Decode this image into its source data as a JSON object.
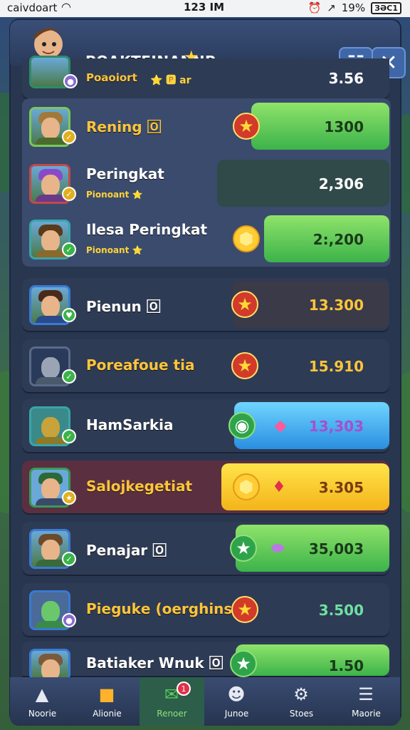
{
  "status_bar": {
    "carrier": "caivdoart",
    "time": "123 IM",
    "battery": "19%",
    "battery_box": "ЗӘС1"
  },
  "header": {
    "title": "POAKTEINANNP",
    "close_icon": "close-icon",
    "grid_icon": "grid-icon"
  },
  "rows": [
    {
      "name": "Poaoiort",
      "sub": "⭐ 🅿 ar",
      "score": "3.56",
      "score_color": "#ffffff"
    },
    {
      "name": "Rening 🄾",
      "sub": "",
      "score": "1300",
      "score_color": "#1a3a1a",
      "bar": "green"
    },
    {
      "name": "Peringkat",
      "sub": "Pionoant ⭐",
      "score": "2,306",
      "score_color": "#ffffff",
      "bar": "dark"
    },
    {
      "name": "Ilesa Peringkat",
      "sub": "Pionoant ⭐",
      "score": "2:,200",
      "score_color": "#1a3a1a",
      "bar": "green"
    },
    {
      "name": "Pienun 🄾",
      "sub": "",
      "score": "13.300",
      "score_color": "#ffc53a"
    },
    {
      "name": "Poreafoue tia",
      "sub": "",
      "score": "15.910",
      "score_color": "#ffc53a"
    },
    {
      "name": "HamSarkia",
      "sub": "",
      "score": "13,303",
      "score_color": "#a44fd0",
      "bar": "blue"
    },
    {
      "name": "Salojkegetiat",
      "sub": "",
      "score": "3.305",
      "score_color": "#7a3a10",
      "bar": "yellow"
    },
    {
      "name": "Penajar 🄾",
      "sub": "",
      "score": "35,003",
      "score_color": "#1a3a1a",
      "bar": "green"
    },
    {
      "name": "Piegukе (oerghins)",
      "sub": "",
      "score": "3.500",
      "score_color": "#6ee0a0"
    },
    {
      "name": "Batiaker Wnuk 🄾",
      "sub": "",
      "score": "1.50",
      "score_color": "#1a3a1a",
      "bar": "green"
    }
  ],
  "tabs": [
    {
      "label": "Noorie",
      "icon": "home-icon"
    },
    {
      "label": "Alionie",
      "icon": "cards-icon"
    },
    {
      "label": "Renoer",
      "icon": "mail-icon"
    },
    {
      "label": "Junoe",
      "icon": "people-icon"
    },
    {
      "label": "Stoes",
      "icon": "settings-icon"
    },
    {
      "label": "Maorie",
      "icon": "menu-icon"
    }
  ],
  "colors": {
    "panel": "#283650",
    "accent_gold": "#ffc53a",
    "bar_green": "#3cb34a",
    "bar_blue": "#2a8ee0",
    "bar_yellow": "#f3b41a"
  }
}
